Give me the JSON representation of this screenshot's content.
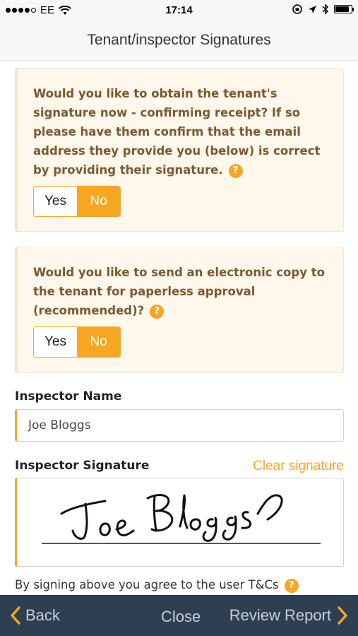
{
  "status_bar": {
    "carrier": "EE",
    "time": "17:14",
    "signal_icon": "signal-dots-icon",
    "wifi_icon": "wifi-icon",
    "battery_level": 0.85
  },
  "nav": {
    "title": "Tenant/inspector Signatures"
  },
  "question1": {
    "text": "Would you like to obtain the tenant's signature now - confirming receipt? If so please have them confirm that the email address they provide you (below) is correct by providing their signature.",
    "help_symbol": "?",
    "yes_label": "Yes",
    "no_label": "No",
    "selected": "No"
  },
  "question2": {
    "text": "Would you like to send an electronic copy to the tenant for paperless approval (recommended)?",
    "help_symbol": "?",
    "yes_label": "Yes",
    "no_label": "No",
    "selected": "No"
  },
  "inspector": {
    "name_label": "Inspector Name",
    "name_value": "Joe Bloggs",
    "signature_label": "Inspector Signature",
    "clear_label": "Clear signature"
  },
  "agreement": {
    "text": "By signing above you agree to the user T&Cs",
    "help_symbol": "?"
  },
  "bottom_nav": {
    "back_label": "Back",
    "close_label": "Close",
    "review_label": "Review Report"
  },
  "colors": {
    "accent": "#f5a623",
    "card_bg": "#fef7eb",
    "card_text": "#7a5a32",
    "bottom_bar": "#2f3f52"
  }
}
